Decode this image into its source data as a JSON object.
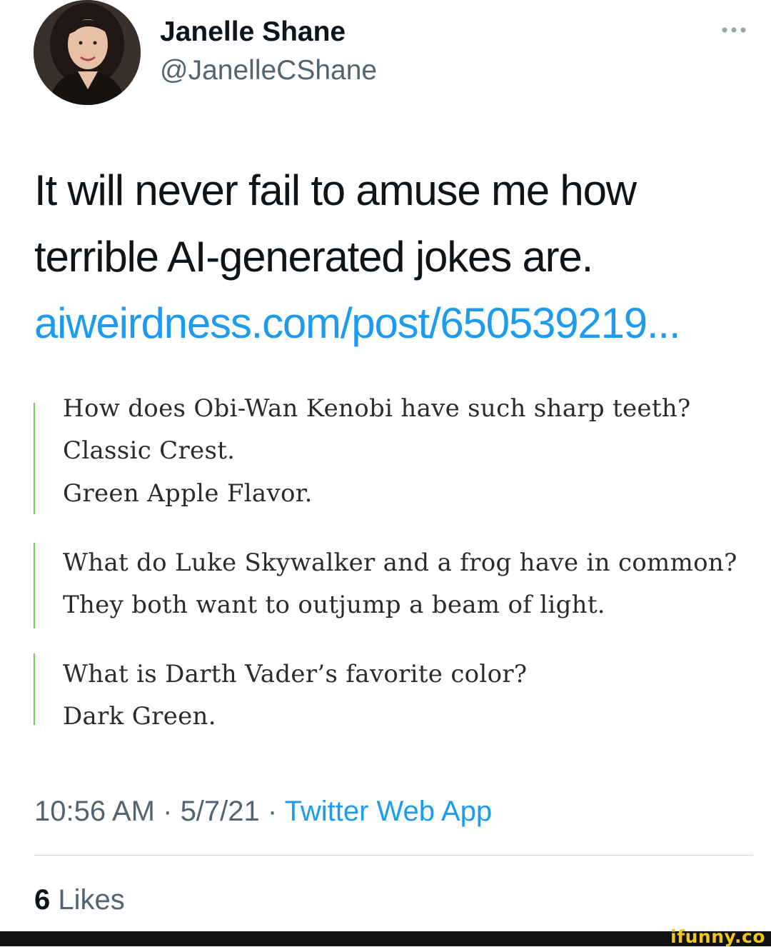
{
  "author": {
    "display_name": "Janelle Shane",
    "handle": "@JanelleCShane",
    "avatar_icon": "profile-photo"
  },
  "more_icon": "more-horizontal-icon",
  "tweet": {
    "text_line_1": "It will never fail to amuse me how",
    "text_line_2": "terrible AI-generated jokes are.",
    "link": "aiweirdness.com/post/650539219..."
  },
  "quotes": [
    {
      "lines": [
        "How does Obi-Wan Kenobi have such sharp teeth?",
        "Classic Crest.",
        "Green Apple Flavor."
      ]
    },
    {
      "lines": [
        "What do Luke Skywalker and a frog have in common?",
        "They both want to outjump a beam of light."
      ]
    },
    {
      "lines": [
        "What is Darth Vader’s favorite color?",
        "Dark Green."
      ]
    }
  ],
  "meta": {
    "time": "10:56 AM",
    "separator": " · ",
    "date": "5/7/21",
    "source": "Twitter Web App"
  },
  "likes": {
    "count": "6",
    "label": "Likes"
  },
  "watermark": "ifunny.co",
  "colors": {
    "link": "#1d9bf0",
    "quote_bar": "#6fcf5b",
    "secondary_text": "#536471",
    "watermark": "#f5c518"
  }
}
